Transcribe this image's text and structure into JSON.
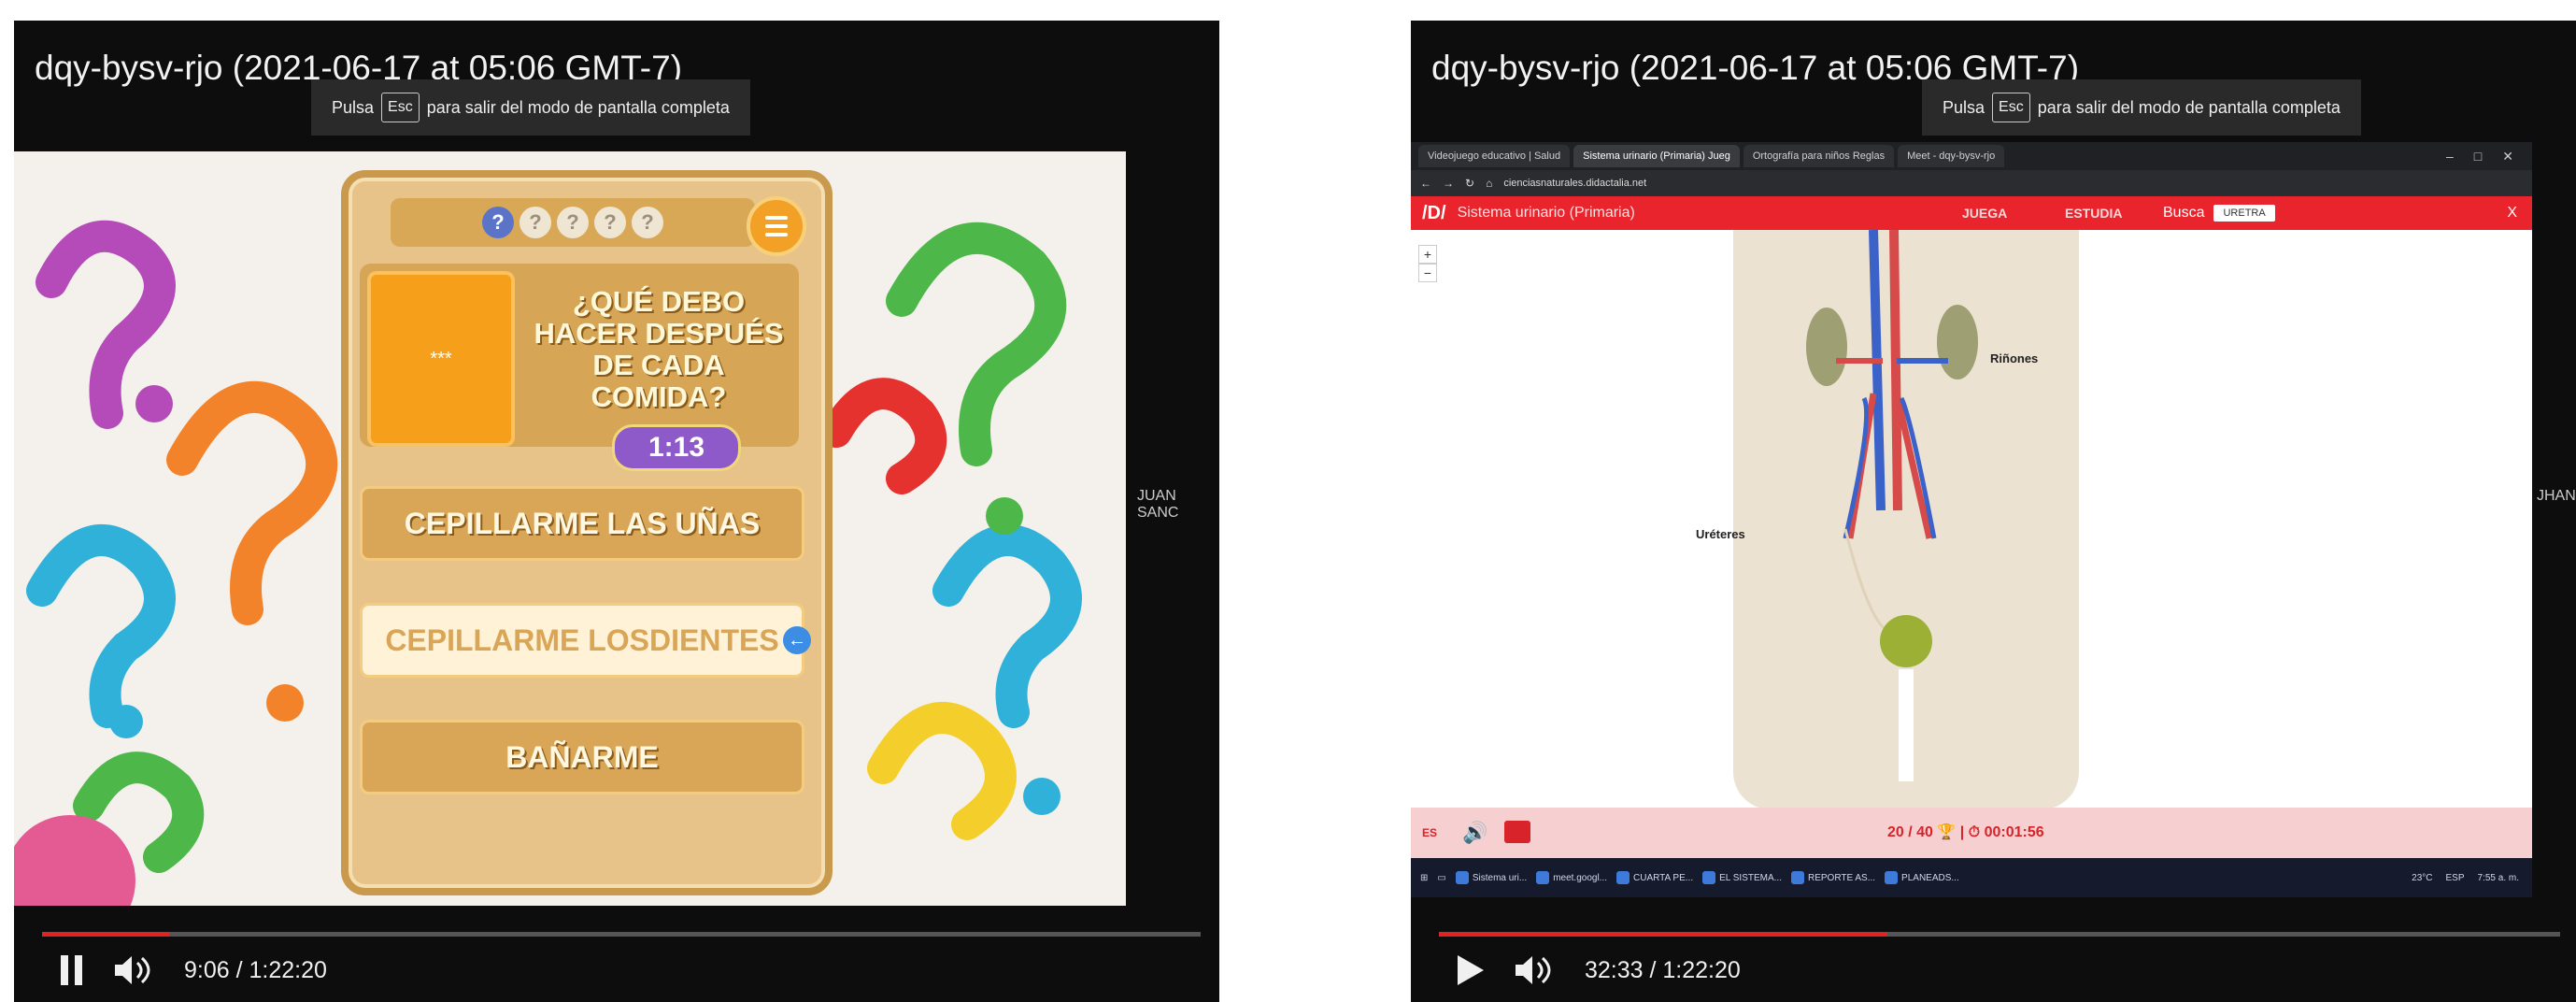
{
  "left_player": {
    "title": "dqy-bysv-rjo (2021-06-17 at 05:06 GMT-7)",
    "esc_banner": {
      "prefix": "Pulsa",
      "key": "Esc",
      "suffix": "para salir del modo de pantalla completa"
    },
    "side_name": "JUAN SANC",
    "progress_fraction": 0.11,
    "time": "9:06 / 1:22:20",
    "play_state": "paused",
    "game": {
      "question_dots": [
        "?",
        "?",
        "?",
        "?",
        "?"
      ],
      "image_label": "***",
      "question": "¿QUÉ DEBO HACER DESPUÉS DE CADA COMIDA?",
      "timer": "1:13",
      "answers": [
        "CEPILLARME LAS UÑAS",
        "CEPILLARME LOSDIENTES",
        "BAÑARME"
      ],
      "selected_answer": 1
    }
  },
  "right_player": {
    "title": "dqy-bysv-rjo (2021-06-17 at 05:06 GMT-7)",
    "esc_banner": {
      "prefix": "Pulsa",
      "key": "Esc",
      "suffix": "para salir del modo de pantalla completa"
    },
    "side_name": "JHAN",
    "progress_fraction": 0.4,
    "time": "32:33 / 1:22:20",
    "play_state": "playing",
    "browser": {
      "tabs": [
        "Videojuego educativo | Salud",
        "Sistema urinario (Primaria) Jueg",
        "Ortografía para niños Reglas",
        "Meet - dqy-bysv-rjo"
      ],
      "active_tab": 1,
      "url": "cienciasnaturales.didactalia.net",
      "app_title": "Sistema urinario (Primaria)",
      "nav": {
        "play": "JUEGA",
        "study": "ESTUDIA"
      },
      "search_label": "Busca",
      "search_value": "URETRA",
      "close": "X",
      "zoom_in": "+",
      "zoom_out": "−",
      "labels": {
        "kidneys": "Riñones",
        "ureters": "Uréteres"
      },
      "lang": "ES",
      "score": "20 / 40",
      "elapsed": "00:01:56",
      "taskbar_items": [
        "Sistema uri...",
        "meet.googl...",
        "CUARTA PE...",
        "EL SISTEMA...",
        "REPORTE AS...",
        "PLANEADS..."
      ],
      "tray_temp": "23°C",
      "tray_lang": "ESP",
      "tray_time": "7:55 a. m."
    }
  },
  "colors": {
    "progress": "#e32222",
    "app_red": "#e9242d",
    "game_gold": "#d9a557",
    "timer_purple": "#8e59c8"
  }
}
